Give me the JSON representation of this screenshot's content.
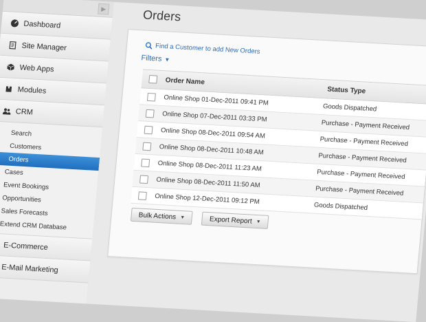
{
  "sidebar": {
    "items": [
      {
        "label": "Dashboard",
        "icon": "dashboard-icon"
      },
      {
        "label": "Site Manager",
        "icon": "document-icon"
      },
      {
        "label": "Web Apps",
        "icon": "cube-icon"
      },
      {
        "label": "Modules",
        "icon": "puzzle-icon"
      },
      {
        "label": "CRM",
        "icon": "users-icon"
      }
    ],
    "crm_sub": [
      "Search",
      "Customers",
      "Orders",
      "Cases",
      "Event Bookings",
      "Opportunities",
      "Sales Forecasts",
      "Extend CRM Database"
    ],
    "after": [
      {
        "label": "E-Commerce",
        "icon": "cart-icon"
      },
      {
        "label": "E-Mail Marketing",
        "icon": "mail-icon"
      }
    ]
  },
  "main": {
    "title": "Orders",
    "find_link": "Find a Customer to add New Orders",
    "filters_label": "Filters",
    "table": {
      "headers": {
        "name": "Order Name",
        "status": "Status Type"
      },
      "rows": [
        {
          "name": "Online Shop 01-Dec-2011 09:41 PM",
          "status": "Goods Dispatched"
        },
        {
          "name": "Online Shop 07-Dec-2011 03:33 PM",
          "status": "Purchase - Payment Received"
        },
        {
          "name": "Online Shop 08-Dec-2011 09:54 AM",
          "status": "Purchase - Payment Received"
        },
        {
          "name": "Online Shop 08-Dec-2011 10:48 AM",
          "status": "Purchase - Payment Received"
        },
        {
          "name": "Online Shop 08-Dec-2011 11:23 AM",
          "status": "Purchase - Payment Received"
        },
        {
          "name": "Online Shop 08-Dec-2011 11:50 AM",
          "status": "Purchase - Payment Received"
        },
        {
          "name": "Online Shop 12-Dec-2011 09:12 PM",
          "status": "Goods Dispatched"
        }
      ]
    },
    "buttons": {
      "bulk": "Bulk Actions",
      "export": "Export Report"
    }
  },
  "colors": {
    "accent": "#2a6db5",
    "active": "#1f6fbf"
  }
}
